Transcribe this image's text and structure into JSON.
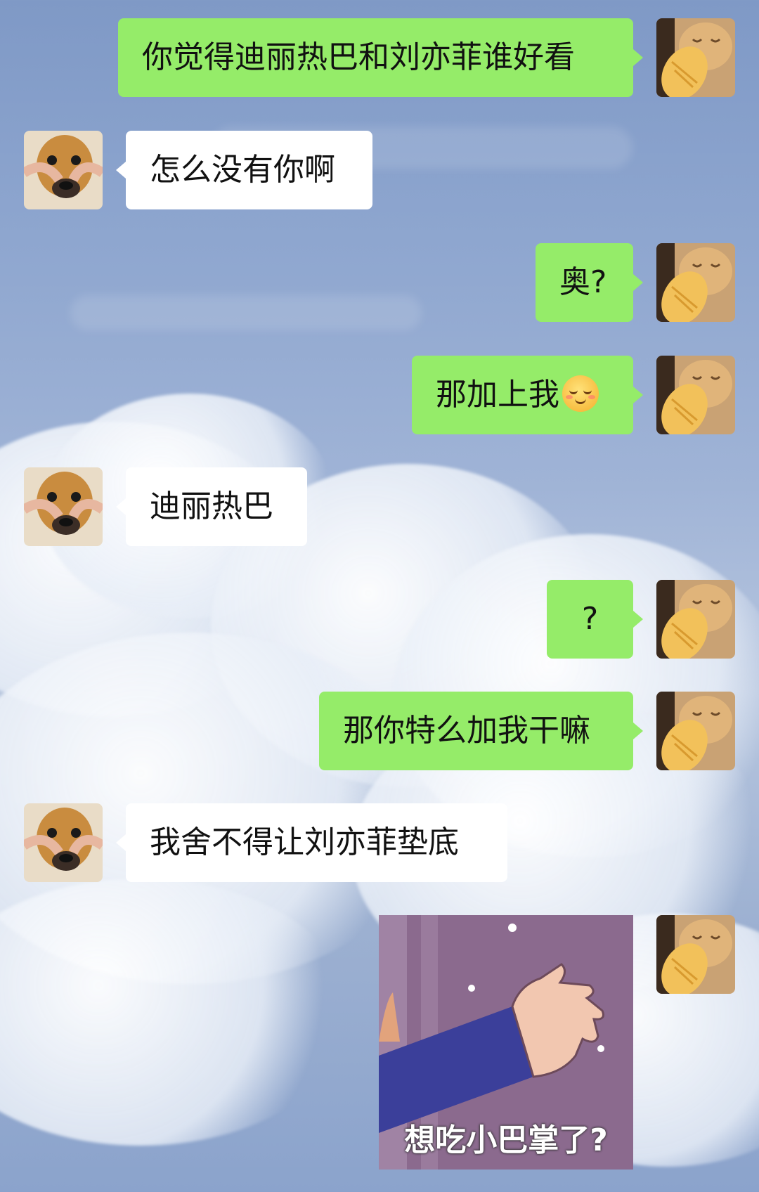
{
  "colors": {
    "sent_bubble": "#95ec69",
    "received_bubble": "#ffffff",
    "text": "#111111"
  },
  "avatars": {
    "me": "cat-holding-fish-avatar",
    "them": "dog-face-squeezed-avatar"
  },
  "messages": [
    {
      "from": "me",
      "text": "你觉得迪丽热巴和刘亦菲谁好看"
    },
    {
      "from": "them",
      "text": "怎么没有你啊"
    },
    {
      "from": "me",
      "text": "奥?"
    },
    {
      "from": "me",
      "text": "那加上我",
      "emoji": "blushing-smile-emoji"
    },
    {
      "from": "them",
      "text": "迪丽热巴"
    },
    {
      "from": "me",
      "text": "?"
    },
    {
      "from": "me",
      "text": "那你特么加我干嘛"
    },
    {
      "from": "them",
      "text": "我舍不得让刘亦菲垫底"
    },
    {
      "from": "me",
      "sticker": {
        "caption": "想吃小巴掌了?",
        "icon": "slapping-hand-sticker"
      }
    }
  ]
}
